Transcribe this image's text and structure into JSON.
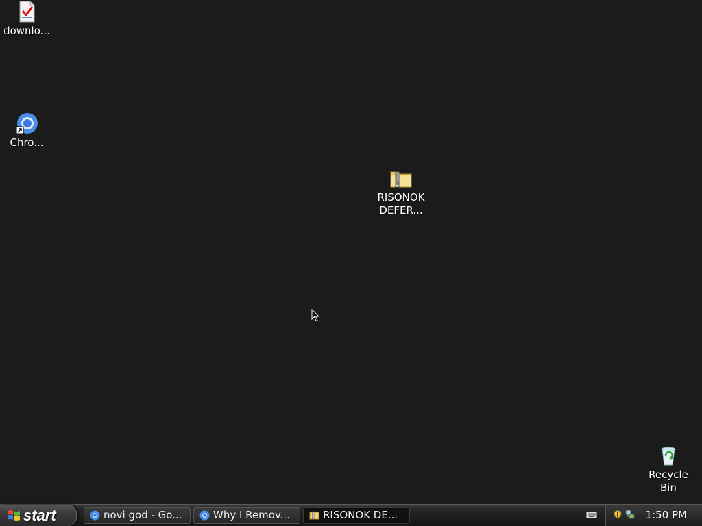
{
  "desktop": {
    "icons": [
      {
        "label": "downlo...",
        "icon": "document-check-icon"
      },
      {
        "label": "Chro...",
        "icon": "chrome-shortcut-icon"
      },
      {
        "label": "RISONOK\nDEFER...",
        "icon": "zip-folder-icon"
      },
      {
        "label": "Recycle\nBin",
        "icon": "recycle-bin-icon"
      }
    ]
  },
  "taskbar": {
    "start_label": "start",
    "tasks": [
      {
        "label": "novi god - Go...",
        "icon": "chrome-icon",
        "active": false
      },
      {
        "label": "Why I Remov...",
        "icon": "chrome-icon",
        "active": false
      },
      {
        "label": "RISONOK DE...",
        "icon": "zip-folder-icon",
        "active": true
      }
    ],
    "tray": {
      "icons": [
        "keyboard-icon",
        "security-shield-icon",
        "network-icon"
      ],
      "clock": "1:50 PM"
    }
  },
  "colors": {
    "desktop_background": "#1b1b1b",
    "taskbar": "#1e1e1e"
  }
}
